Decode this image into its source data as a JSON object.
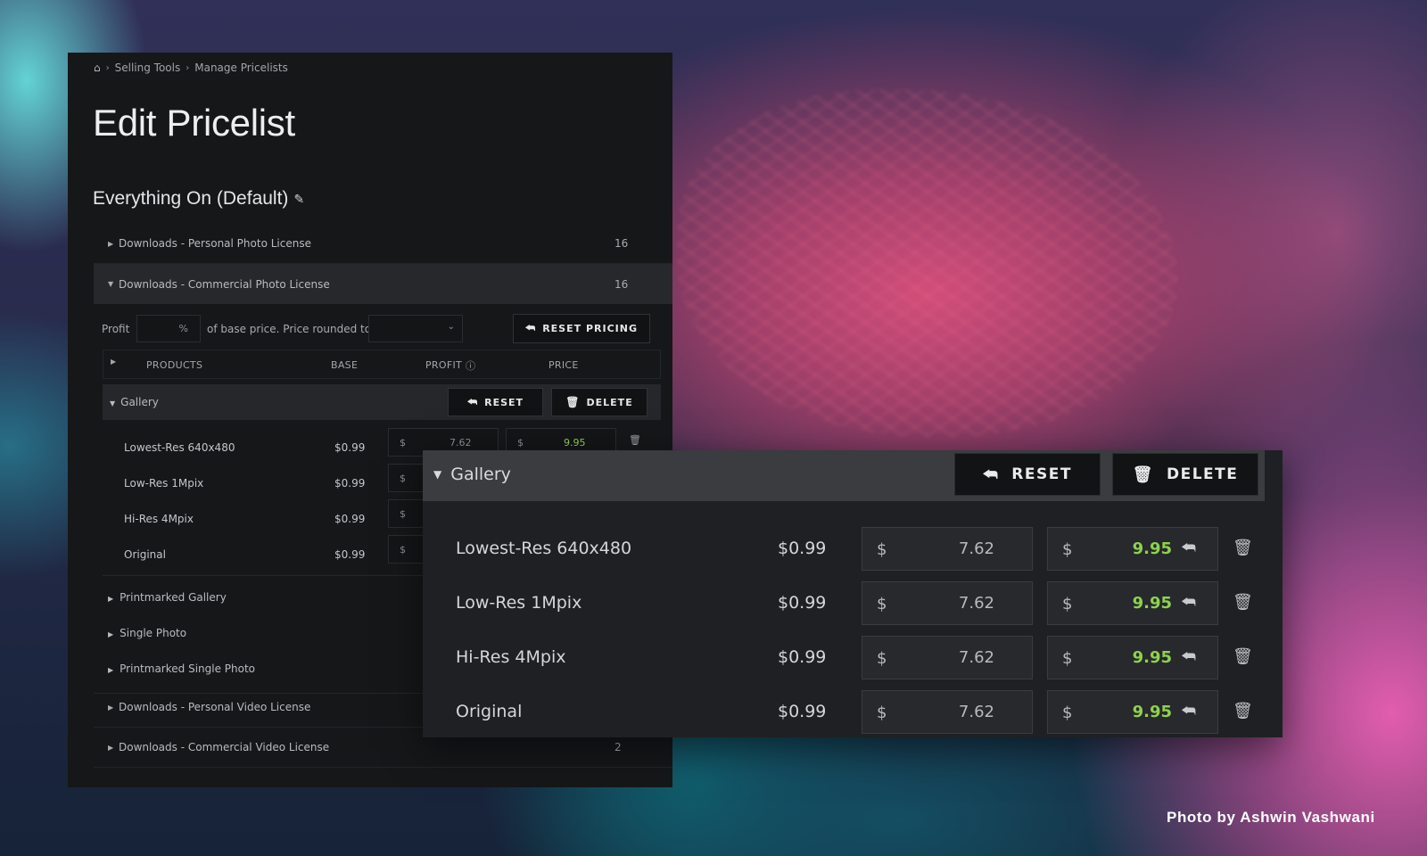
{
  "breadcrumb": {
    "home_icon": "home-icon",
    "items": [
      "Selling Tools",
      "Manage Pricelists"
    ]
  },
  "page_title": "Edit Pricelist",
  "pricelist_name": "Everything On (Default)",
  "sections": [
    {
      "label": "Downloads - Personal Photo License",
      "count": "16",
      "expanded": false
    },
    {
      "label": "Downloads - Commercial Photo License",
      "count": "16",
      "expanded": true
    },
    {
      "label": "Downloads - Personal Video License",
      "count": "",
      "expanded": false
    },
    {
      "label": "Downloads - Commercial Video License",
      "count": "2",
      "expanded": false
    }
  ],
  "profit_bar": {
    "label": "Profit",
    "percent_sign": "%",
    "text": "of base price. Price rounded to",
    "reset_pricing": "RESET PRICING"
  },
  "table_header": {
    "products": "PRODUCTS",
    "base": "BASE",
    "profit": "PROFIT",
    "price": "PRICE"
  },
  "gallery": {
    "label": "Gallery",
    "reset": "RESET",
    "delete": "DELETE",
    "products": [
      {
        "name": "Lowest-Res 640x480",
        "base": "$0.99",
        "currency": "$",
        "profit": "7.62",
        "price": "9.95"
      },
      {
        "name": "Low-Res 1Mpix",
        "base": "$0.99",
        "currency": "$",
        "profit": "7.62",
        "price": "9.95"
      },
      {
        "name": "Hi-Res 4Mpix",
        "base": "$0.99",
        "currency": "$",
        "profit": "7.62",
        "price": "9.95"
      },
      {
        "name": "Original",
        "base": "$0.99",
        "currency": "$",
        "profit": "7.62",
        "price": "9.95"
      }
    ]
  },
  "subgroups": [
    "Printmarked Gallery",
    "Single Photo",
    "Printmarked Single Photo"
  ],
  "photo_credit": "Photo by Ashwin Vashwani",
  "colors": {
    "price_green": "#8fd14f",
    "panel_bg": "#161719"
  }
}
